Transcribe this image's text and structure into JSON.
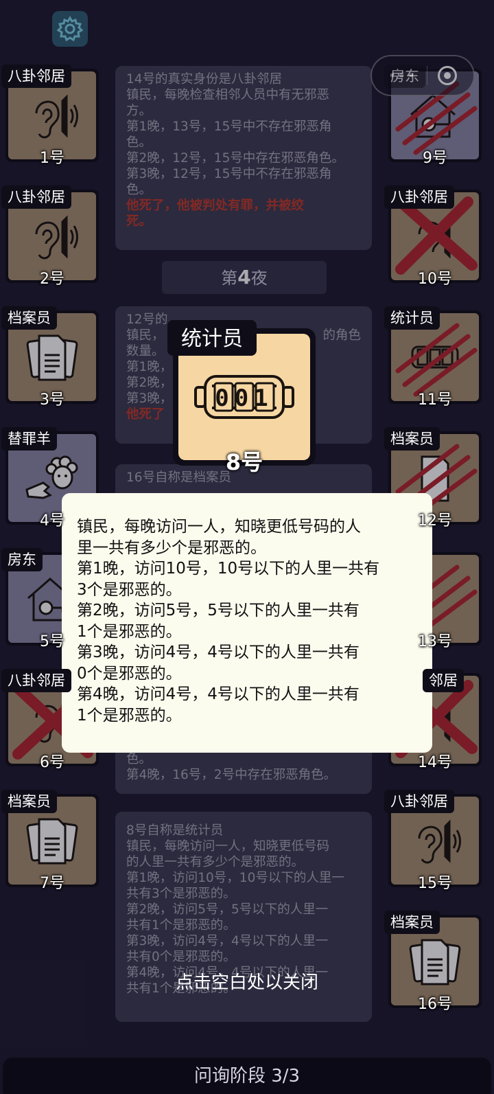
{
  "header": {
    "settings_icon": "gear-icon",
    "capsule_menu": "•••",
    "capsule_close_icon": "target-close-icon"
  },
  "players": {
    "left": [
      {
        "role": "八卦邻居",
        "num": "1号",
        "icon": "ear-icon",
        "dead": false
      },
      {
        "role": "八卦邻居",
        "num": "2号",
        "icon": "ear-icon",
        "dead": false
      },
      {
        "role": "档案员",
        "num": "3号",
        "icon": "documents-icon",
        "dead": false
      },
      {
        "role": "替罪羊",
        "num": "4号",
        "icon": "sheep-icon",
        "dead": false
      },
      {
        "role": "房东",
        "num": "5号",
        "icon": "house-key-icon",
        "dead": false
      },
      {
        "role": "八卦邻居",
        "num": "6号",
        "icon": "ear-icon",
        "dead": true
      },
      {
        "role": "档案员",
        "num": "7号",
        "icon": "documents-icon",
        "dead": false
      }
    ],
    "right": [
      {
        "role": "房东",
        "num": "9号",
        "icon": "house-key-icon",
        "dead": "scratch"
      },
      {
        "role": "八卦邻居",
        "num": "10号",
        "icon": "ear-icon",
        "dead": "cross"
      },
      {
        "role": "统计员",
        "num": "11号",
        "icon": "counter-icon",
        "dead": "scratch"
      },
      {
        "role": "档案员",
        "num": "12号",
        "icon": "documents-icon",
        "dead": "scratch"
      },
      {
        "role": "",
        "num": "13号",
        "icon": "unknown",
        "dead": "scratch"
      },
      {
        "role": "邻居",
        "num": "14号",
        "icon": "ear-icon",
        "dead": "cross"
      },
      {
        "role": "八卦邻居",
        "num": "15号",
        "icon": "ear-icon",
        "dead": false
      },
      {
        "role": "档案员",
        "num": "16号",
        "icon": "documents-icon",
        "dead": false
      }
    ]
  },
  "log": {
    "entry1": {
      "lines": [
        "14号的真实身份是八卦邻居",
        "镇民，每晚检查相邻人员中有无邪恶",
        "方。",
        "第1晚，13号，15号中不存在邪恶角",
        "色。",
        "第2晚，12号，15号中存在邪恶角色。",
        "第3晚，12号，15号中不存在邪恶角",
        "色。"
      ],
      "red_lines": [
        "他死了，他被判处有罪，并被绞",
        "死。"
      ]
    },
    "night_prefix": "第",
    "night_num": "4",
    "night_suffix": "夜",
    "entry2": {
      "lines": [
        "12号的",
        "镇民，",
        "数量。",
        "第1晚，",
        "第2晚，",
        "第3晚，"
      ],
      "right_fragment": "的角色",
      "red_line": "他死了"
    },
    "entry3": {
      "first_line": "16号自称是档案员",
      "tail_lines": [
        "色。",
        "第4晚，16号，2号中存在邪恶角色。"
      ]
    },
    "entry4": {
      "lines": [
        "8号自称是统计员",
        "镇民，每晚访问一人，知晓更低号码",
        "的人里一共有多少个是邪恶的。",
        "第1晚，访问10号，10号以下的人里一",
        "共有3个是邪恶的。",
        "第2晚，访问5号，5号以下的人里一",
        "共有1个是邪恶的。",
        "第3晚，访问4号，4号以下的人里一",
        "共有0个是邪恶的。",
        "第4晚，访问4号，4号以下的人里一",
        "共有1个是邪恶的。"
      ]
    }
  },
  "popup": {
    "role": "统计员",
    "num": "8号",
    "counter_digits": "001",
    "description": [
      "镇民，每晚访问一人，知晓更低号码的人",
      "里一共有多少个是邪恶的。",
      "第1晚，访问10号，10号以下的人里一共有",
      "3个是邪恶的。",
      "第2晚，访问5号，5号以下的人里一共有",
      "1个是邪恶的。",
      "第3晚，访问4号，4号以下的人里一共有",
      "0个是邪恶的。",
      "第4晚，访问4号，4号以下的人里一共有",
      "1个是邪恶的。"
    ],
    "close_hint": "点击空白处以关闭"
  },
  "footer": {
    "phase": "问询阶段 3/3"
  },
  "colors": {
    "background": "#1c1a2e",
    "card_tan": "#a68f70",
    "card_purple": "#8a87a6",
    "dead_red": "#b3262e",
    "popup_bg": "#fbfbee"
  }
}
